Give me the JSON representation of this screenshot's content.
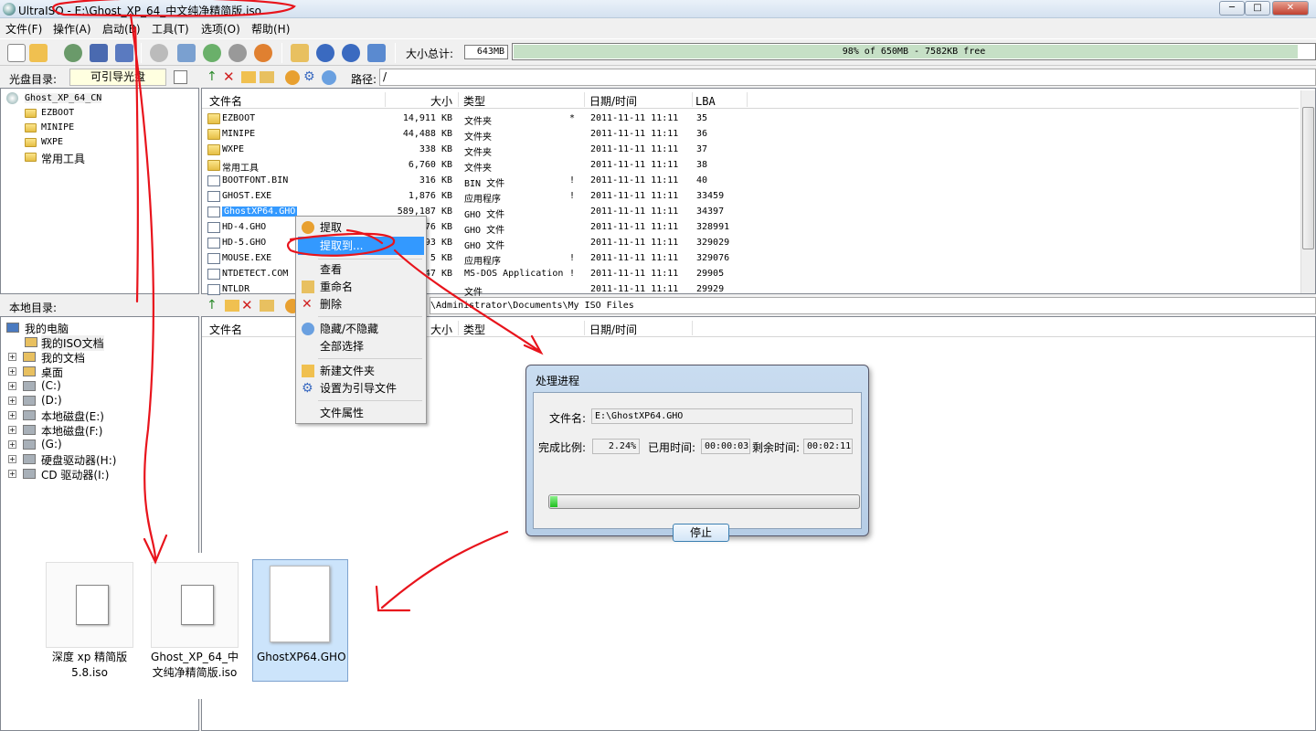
{
  "window": {
    "title": "UltraISO - E:\\Ghost_XP_64_中文纯净精简版.iso",
    "min": "─",
    "max": "□",
    "close": "✕"
  },
  "menu": [
    "文件(F)",
    "操作(A)",
    "启动(B)",
    "工具(T)",
    "选项(O)",
    "帮助(H)"
  ],
  "toolbar": {
    "size_label": "大小总计:",
    "size_value": "643MB",
    "capacity_text": "98% of 650MB - 7582KB free",
    "capacity_fraction": 0.98
  },
  "disc": {
    "label": "光盘目录:",
    "boot_label": "可引导光盘",
    "path_label": "路径:",
    "path": "/",
    "tree": [
      "Ghost_XP_64_CN",
      "EZBOOT",
      "MINIPE",
      "WXPE",
      "常用工具"
    ],
    "columns": [
      "文件名",
      "大小",
      "类型",
      "日期/时间",
      "LBA"
    ],
    "files": [
      {
        "name": "EZBOOT",
        "size": "14,911 KB",
        "type": "文件夹",
        "flag": "*",
        "date": "2011-11-11 11:11",
        "lba": "35",
        "icon": "folder"
      },
      {
        "name": "MINIPE",
        "size": "44,488 KB",
        "type": "文件夹",
        "flag": "",
        "date": "2011-11-11 11:11",
        "lba": "36",
        "icon": "folder"
      },
      {
        "name": "WXPE",
        "size": "338 KB",
        "type": "文件夹",
        "flag": "",
        "date": "2011-11-11 11:11",
        "lba": "37",
        "icon": "folder"
      },
      {
        "name": "常用工具",
        "size": "6,760 KB",
        "type": "文件夹",
        "flag": "",
        "date": "2011-11-11 11:11",
        "lba": "38",
        "icon": "folder"
      },
      {
        "name": "BOOTFONT.BIN",
        "size": "316 KB",
        "type": "BIN 文件",
        "flag": "!",
        "date": "2011-11-11 11:11",
        "lba": "40",
        "icon": "file"
      },
      {
        "name": "GHOST.EXE",
        "size": "1,876 KB",
        "type": "应用程序",
        "flag": "!",
        "date": "2011-11-11 11:11",
        "lba": "33459",
        "icon": "file"
      },
      {
        "name": "GhostXP64.GHO",
        "size": "589,187 KB",
        "type": "GHO 文件",
        "flag": "",
        "date": "2011-11-11 11:11",
        "lba": "34397",
        "icon": "file"
      },
      {
        "name": "HD-4.GHO",
        "size": "76 KB",
        "type": "GHO 文件",
        "flag": "",
        "date": "2011-11-11 11:11",
        "lba": "328991",
        "icon": "file"
      },
      {
        "name": "HD-5.GHO",
        "size": "93 KB",
        "type": "GHO 文件",
        "flag": "",
        "date": "2011-11-11 11:11",
        "lba": "329029",
        "icon": "file"
      },
      {
        "name": "MOUSE.EXE",
        "size": "5 KB",
        "type": "应用程序",
        "flag": "!",
        "date": "2011-11-11 11:11",
        "lba": "329076",
        "icon": "file"
      },
      {
        "name": "NTDETECT.COM",
        "size": "47 KB",
        "type": "MS-DOS Application",
        "flag": "!",
        "date": "2011-11-11 11:11",
        "lba": "29905",
        "icon": "file"
      },
      {
        "name": "NTLDR",
        "size": "",
        "type": "文件",
        "flag": "",
        "date": "2011-11-11 11:11",
        "lba": "29929",
        "icon": "file"
      }
    ]
  },
  "local": {
    "label": "本地目录:",
    "path": "\\Administrator\\Documents\\My ISO Files",
    "tree": [
      "我的电脑",
      "我的ISO文档",
      "我的文档",
      "桌面",
      "(C:)",
      "(D:)",
      "本地磁盘(E:)",
      "本地磁盘(F:)",
      "(G:)",
      "硬盘驱动器(H:)",
      "CD 驱动器(I:)"
    ],
    "columns": [
      "文件名",
      "大小",
      "类型",
      "日期/时间"
    ]
  },
  "context_menu": [
    "提取",
    "提取到...",
    "查看",
    "重命名",
    "删除",
    "隐藏/不隐藏",
    "全部选择",
    "新建文件夹",
    "设置为引导文件",
    "文件属性"
  ],
  "dialog": {
    "title": "处理进程",
    "filename_label": "文件名:",
    "filename": "E:\\GhostXP64.GHO",
    "ratio_label": "完成比例:",
    "ratio": "2.24%",
    "progress": 0.0224,
    "elapsed_label": "已用时间:",
    "elapsed": "00:00:03",
    "remain_label": "剩余时间:",
    "remain": "00:02:11",
    "stop": "停止"
  },
  "explorer_items": [
    "深度 xp 精简版 5.8.iso",
    "Ghost_XP_64_中文纯净精简版.iso",
    "GhostXP64.GHO"
  ],
  "annotation_color": "#e8141c"
}
